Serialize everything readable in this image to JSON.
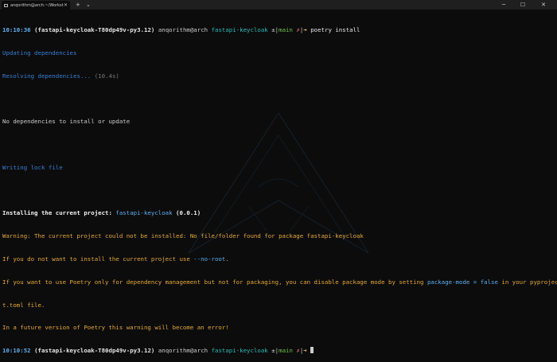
{
  "window": {
    "tab_title": "anqorithm@arch:~/Workstati",
    "tab_close": "✕",
    "new_tab": "+",
    "dropdown": "⌄",
    "minimize": "─",
    "maximize": "☐",
    "close": "✕"
  },
  "prompt1": {
    "time": "10:10:36",
    "venv": "(fastapi-keycloak-T80dp49v-py3.12)",
    "user": "anqorithm@arch",
    "dir": "fastapi-keycloak",
    "git_open": "±|",
    "branch": "main",
    "dirty": "✗",
    "git_close": "|",
    "arrow": "➜",
    "command": "poetry install"
  },
  "output": {
    "updating": "Updating dependencies",
    "resolving": "Resolving dependencies...",
    "resolving_time": "(10.4s)",
    "no_deps": "No dependencies to install or update",
    "writing_lock": "Writing lock file",
    "installing_prefix": "Installing the current project: ",
    "project_name": "fastapi-keycloak",
    "project_version": "(0.0.1)",
    "warning1": "Warning: The current project could not be installed: No file/folder found for package fastapi-keycloak",
    "warning2_pre": "If you do not want to install the current project use ",
    "warning2_flag": "--no-root",
    "warning2_post": ".",
    "warning3_pre": "If you want to use Poetry only for dependency management but not for packaging, you can disable package mode by setting ",
    "warning3_setting": "package-mode = false",
    "warning3_post": " in your pyprojec",
    "warning3_wrap": "t.toml file.",
    "warning4": "In a future version of Poetry this warning will become an error!"
  },
  "prompt2": {
    "time": "10:10:52",
    "venv": "(fastapi-keycloak-T80dp49v-py3.12)",
    "user": "anqorithm@arch",
    "dir": "fastapi-keycloak",
    "git_open": "±|",
    "branch": "main",
    "dirty": "✗",
    "git_close": "|",
    "arrow": "➜"
  },
  "background_logo": "arch-linux-logo",
  "colors": {
    "background": "#0c0c0c",
    "prompt_time": "#61afef",
    "warning": "#e5a93c",
    "info": "#3a7ed8",
    "branch": "#6cc24a"
  }
}
